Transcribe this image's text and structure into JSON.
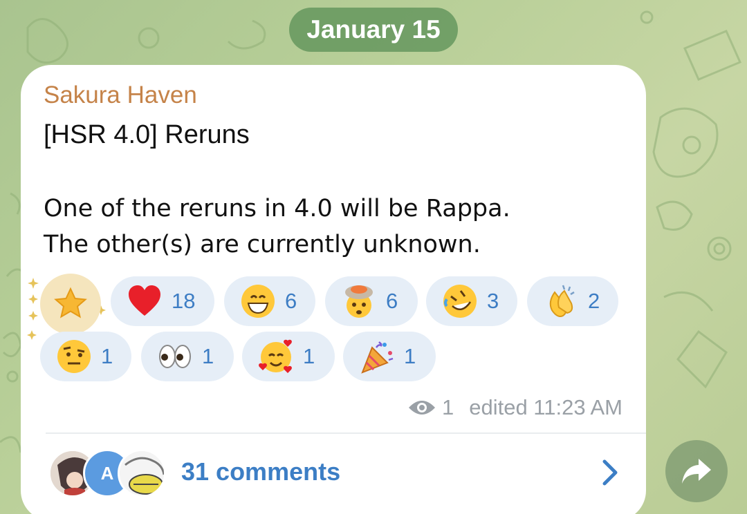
{
  "date_separator": "January 15",
  "message": {
    "sender": "Sakura Haven",
    "title": "[HSR 4.0] Reruns",
    "body_line1": "One of the reruns in 4.0 will be Rappa.",
    "body_line2": "The other(s) are currently unknown.",
    "reactions": [
      {
        "emoji": "star-icon",
        "count": "",
        "selected": true
      },
      {
        "emoji": "red-heart-icon",
        "count": "18"
      },
      {
        "emoji": "grinning-face-icon",
        "count": "6"
      },
      {
        "emoji": "exploding-head-icon",
        "count": "6"
      },
      {
        "emoji": "rofl-face-icon",
        "count": "3"
      },
      {
        "emoji": "clapping-hands-icon",
        "count": "2"
      },
      {
        "emoji": "raised-eyebrow-face-icon",
        "count": "1"
      },
      {
        "emoji": "eyes-icon",
        "count": "1"
      },
      {
        "emoji": "smiling-face-with-hearts-icon",
        "count": "1"
      },
      {
        "emoji": "party-popper-icon",
        "count": "1"
      }
    ],
    "views": "1",
    "edited_label": "edited 11:23 AM",
    "comments": {
      "label": "31 comments",
      "avatar_letter": "A"
    }
  },
  "colors": {
    "sender": "#c58349",
    "accent": "#3c7ec5",
    "reaction_bg": "#e6eef7",
    "date_pill": "#689860"
  }
}
